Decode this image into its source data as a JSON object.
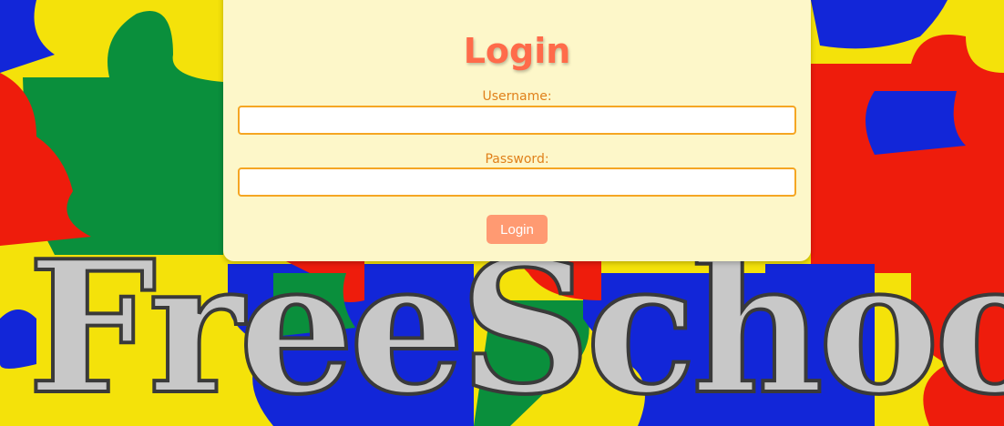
{
  "background": {
    "logo_text": "FreeSchool",
    "colors": {
      "yellow": "#f4e20a",
      "green": "#0a8f3c",
      "red": "#ee1c0c",
      "blue": "#1226d8"
    }
  },
  "login": {
    "title": "Login",
    "username_label": "Username:",
    "username_value": "",
    "password_label": "Password:",
    "password_value": "",
    "submit_label": "Login"
  },
  "colors": {
    "card_bg": "#fdf7c9",
    "title": "#ff6b4a",
    "label": "#e0801a",
    "input_border": "#f5a623",
    "button_bg": "#ff9a72"
  }
}
